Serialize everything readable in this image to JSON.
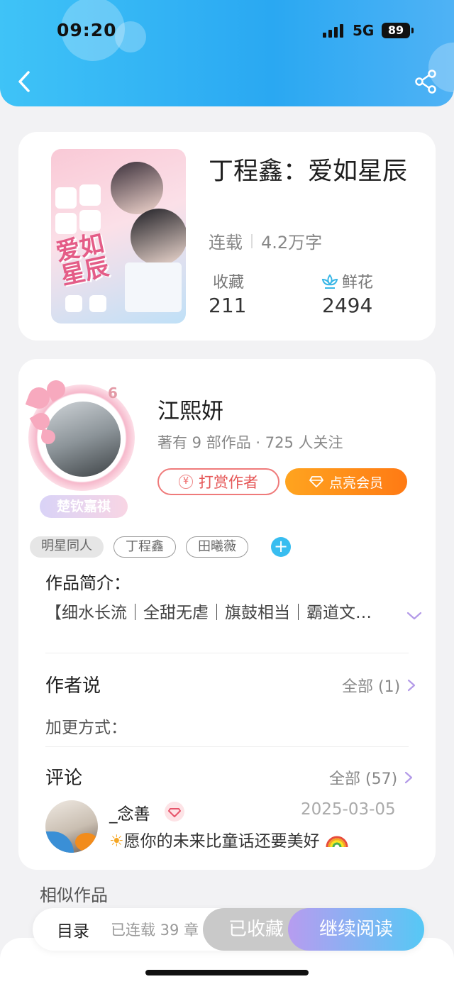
{
  "status_bar": {
    "time": "09:20",
    "network": "5G",
    "battery": "89"
  },
  "nav": {
    "back_icon": "chevron-left-icon",
    "share_icon": "share-icon"
  },
  "book": {
    "title": "丁程鑫：爱如星辰",
    "status": "连载",
    "word_count": "4.2万字",
    "favorites_label": "收藏",
    "favorites_value": "211",
    "flowers_label": "鲜花",
    "flowers_value": "2494",
    "cover_text": "爱如星辰"
  },
  "author": {
    "name": "江熙妍",
    "stats": "著有 9 部作品 · 725 人关注",
    "level": "6",
    "fan_tag": "楚钦嘉祺",
    "tip_button": "打赏作者",
    "vip_button": "点亮会员"
  },
  "tags": [
    "明星同人",
    "丁程鑫",
    "田曦薇"
  ],
  "intro": {
    "label": "作品简介：",
    "text": "【细水长流｜全甜无虐｜旗鼓相当｜霸道文…"
  },
  "author_says": {
    "heading": "作者说",
    "all_label": "全部 (1)",
    "text": "加更方式："
  },
  "comments": {
    "heading": "评论",
    "all_label": "全部 (57)",
    "items": [
      {
        "user": "_念善",
        "date": "2025-03-05",
        "text": "愿你的未来比童话还要美好"
      }
    ]
  },
  "similar": {
    "heading": "相似作品"
  },
  "bottom_bar": {
    "toc": "目录",
    "chapters": "已连载 39 章",
    "collected": "已收藏",
    "continue": "继续阅读"
  },
  "colors": {
    "header": "#2aa8f2",
    "vip_orange": "#ff8a1a",
    "tip_red": "#e55555",
    "read_gradient_start": "#b79cf0",
    "read_gradient_end": "#56c8f5"
  }
}
